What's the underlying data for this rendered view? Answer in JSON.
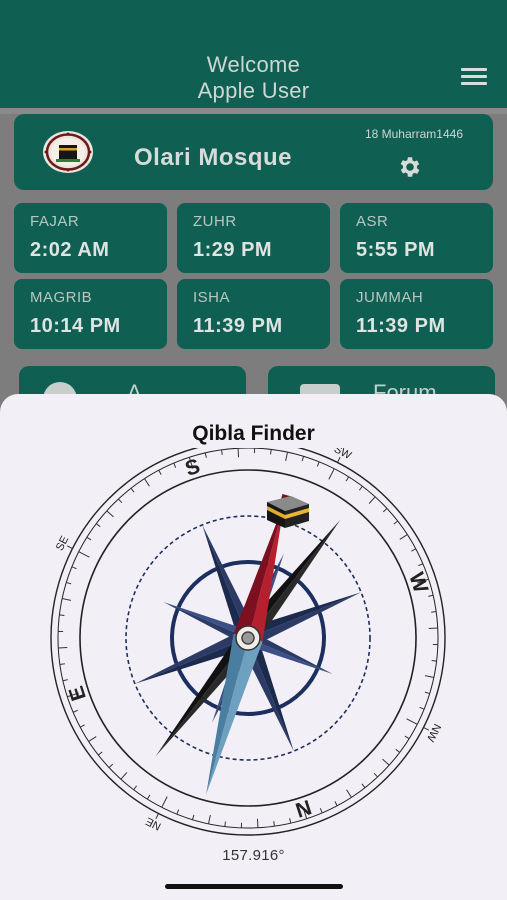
{
  "header": {
    "welcome_line1": "Welcome",
    "welcome_line2": "Apple User",
    "menu_icon": "hamburger-menu-icon"
  },
  "mosque": {
    "name": "Olari Mosque",
    "hijri_date": "18 Muharram1446",
    "settings_icon": "gear-icon",
    "logo_icon": "kaaba-logo-icon"
  },
  "prayers": [
    {
      "name": "FAJAR",
      "time": "2:02 AM"
    },
    {
      "name": "ZUHR",
      "time": "1:29 PM"
    },
    {
      "name": "ASR",
      "time": "5:55 PM"
    },
    {
      "name": "MAGRIB",
      "time": "10:14 PM"
    },
    {
      "name": "ISHA",
      "time": "11:39 PM"
    },
    {
      "name": "JUMMAH",
      "time": "11:39 PM"
    }
  ],
  "shortcuts": [
    {
      "label": "A",
      "icon": "announcement-icon"
    },
    {
      "label": "Forum",
      "icon": "forum-icon"
    }
  ],
  "qibla": {
    "title": "Qibla Finder",
    "heading_text": "157.916°",
    "heading_degrees": 157.916,
    "cardinal_labels": [
      "S",
      "SW",
      "W",
      "NW",
      "N",
      "NE",
      "E",
      "SE"
    ]
  },
  "colors": {
    "brand_green": "#0f5f52",
    "needle_red": "#a3192a",
    "needle_blue": "#4f86a8",
    "rose_navy": "#2e3f6e"
  }
}
